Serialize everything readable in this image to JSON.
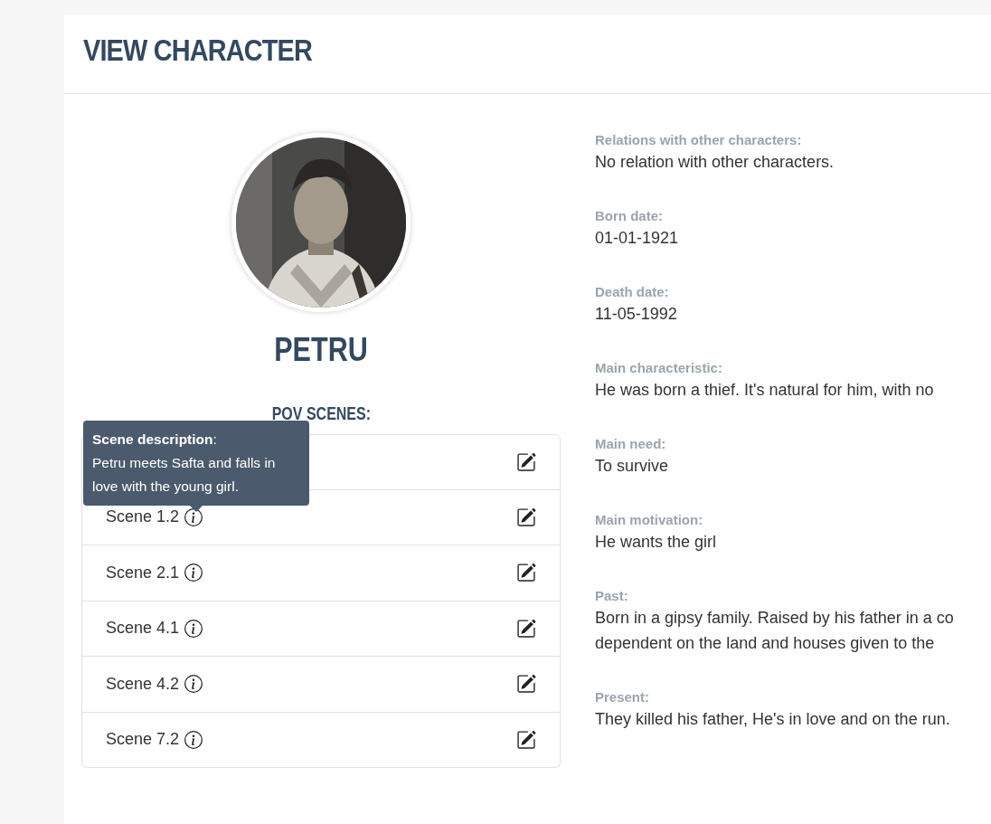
{
  "page": {
    "title": "VIEW CHARACTER"
  },
  "character": {
    "name": "PETRU"
  },
  "pov_scenes": {
    "heading": "POV SCENES:",
    "rows": [
      {
        "kind": "covered"
      },
      {
        "kind": "scene",
        "label": "Scene 1.2"
      },
      {
        "kind": "scene",
        "label": "Scene 2.1"
      },
      {
        "kind": "scene",
        "label": "Scene 4.1"
      },
      {
        "kind": "scene",
        "label": "Scene 4.2"
      },
      {
        "kind": "scene",
        "label": "Scene 7.2"
      }
    ]
  },
  "tooltip": {
    "title": "**Scene description**:",
    "text": "Petru meets Safta and falls in love with the young girl."
  },
  "fields": [
    {
      "label": "Relations with other characters:",
      "lines": [
        "No relation with other characters."
      ]
    },
    {
      "label": "Born date:",
      "lines": [
        "01-01-1921"
      ]
    },
    {
      "label": "Death date:",
      "lines": [
        "11-05-1992"
      ]
    },
    {
      "label": "Main characteristic:",
      "lines": [
        "He was born a thief. It's natural for him, with no"
      ]
    },
    {
      "label": "Main need:",
      "lines": [
        "To survive"
      ]
    },
    {
      "label": "Main motivation:",
      "lines": [
        "He wants the girl"
      ]
    },
    {
      "label": "Past:",
      "lines": [
        "Born in a gipsy family. Raised by his father in a co",
        "dependent on the land and houses given to the"
      ]
    },
    {
      "label": "Present:",
      "lines": [
        "They killed his father, He's in love and on the run."
      ]
    }
  ]
}
